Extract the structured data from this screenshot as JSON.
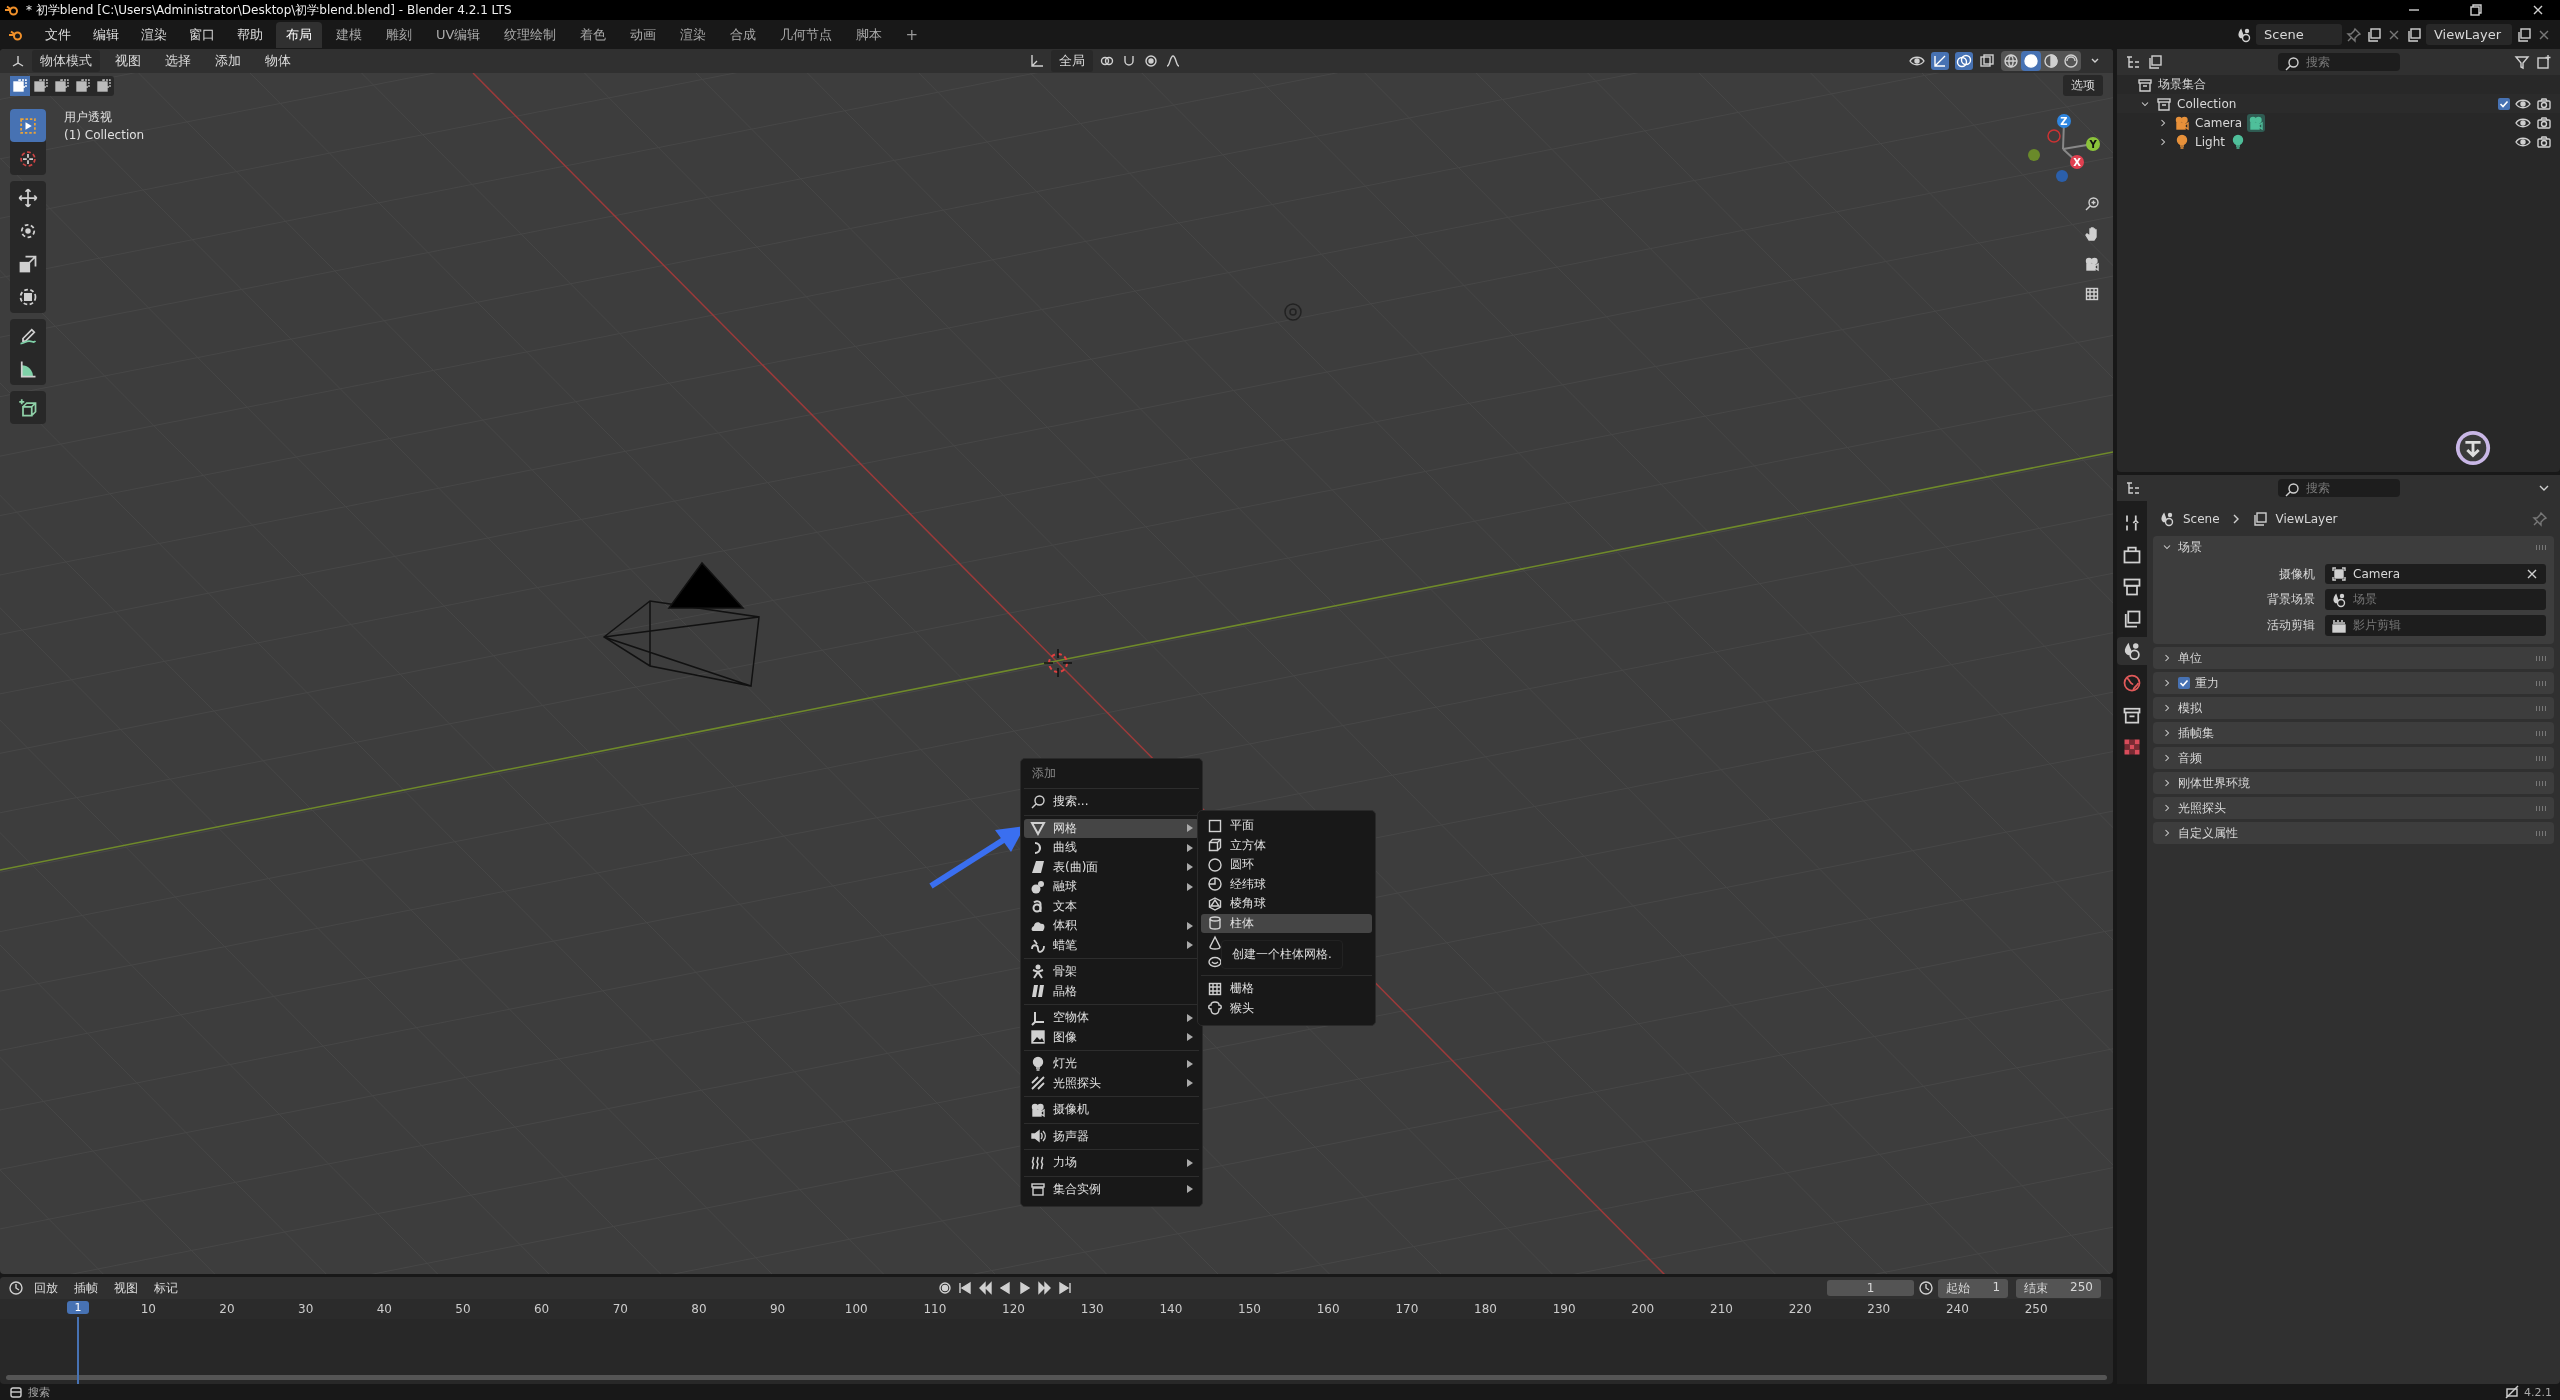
{
  "title_bar": {
    "title": "* 初学blend [C:\\Users\\Administrator\\Desktop\\初学blend.blend] - Blender 4.2.1 LTS"
  },
  "menu_bar": [
    "文件",
    "编辑",
    "渲染",
    "窗口",
    "帮助"
  ],
  "workspaces": [
    {
      "label": "布局",
      "selected": true
    },
    {
      "label": "建模",
      "selected": false
    },
    {
      "label": "雕刻",
      "selected": false
    },
    {
      "label": "UV编辑",
      "selected": false
    },
    {
      "label": "纹理绘制",
      "selected": false
    },
    {
      "label": "着色",
      "selected": false
    },
    {
      "label": "动画",
      "selected": false
    },
    {
      "label": "渲染",
      "selected": false
    },
    {
      "label": "合成",
      "selected": false
    },
    {
      "label": "几何节点",
      "selected": false
    },
    {
      "label": "脚本",
      "selected": false
    }
  ],
  "add_workspace": "+",
  "scene": "Scene",
  "view_layer": "ViewLayer",
  "viewport": {
    "mode": "物体模式",
    "menus": [
      "视图",
      "选择",
      "添加",
      "物体"
    ],
    "orientation": "全局",
    "options": "选项",
    "select_modes": [
      {
        "selected": true
      },
      {
        "selected": false
      },
      {
        "selected": false
      },
      {
        "selected": false
      },
      {
        "selected": false
      }
    ],
    "shading": [
      {
        "kind": "wireframe",
        "selected": false
      },
      {
        "kind": "solid",
        "selected": true
      },
      {
        "kind": "material",
        "selected": false
      },
      {
        "kind": "rendered",
        "selected": false
      }
    ],
    "overlay_text": [
      "用户透视",
      "(1) Collection"
    ],
    "tools": [
      [
        {
          "kind": "sel",
          "selected": true
        },
        {
          "kind": "cursor3d",
          "selected": false
        }
      ],
      [
        {
          "kind": "move",
          "selected": false
        },
        {
          "kind": "rotate",
          "selected": false
        },
        {
          "kind": "scale",
          "selected": false
        },
        {
          "kind": "transform",
          "selected": false
        }
      ],
      [
        {
          "kind": "annotate",
          "selected": false
        },
        {
          "kind": "measure",
          "selected": false
        }
      ],
      [
        {
          "kind": "addcube",
          "selected": false
        }
      ]
    ],
    "gizmo": {
      "x": "X",
      "y": "Y",
      "z": "Z"
    }
  },
  "add_menu": {
    "title": "添加",
    "groups": [
      [
        {
          "label": "搜索...",
          "kind": "search",
          "has_submenu": false,
          "selected": false
        }
      ],
      [
        {
          "label": "网格",
          "kind": "mesh",
          "has_submenu": true,
          "selected": true
        },
        {
          "label": "曲线",
          "kind": "curve",
          "has_submenu": true,
          "selected": false
        },
        {
          "label": "表(曲)面",
          "kind": "surface",
          "has_submenu": true,
          "selected": false
        },
        {
          "label": "融球",
          "kind": "metaball",
          "has_submenu": true,
          "selected": false
        },
        {
          "label": "文本",
          "kind": "text",
          "has_submenu": false,
          "selected": false
        },
        {
          "label": "体积",
          "kind": "volume",
          "has_submenu": true,
          "selected": false
        },
        {
          "label": "蜡笔",
          "kind": "gpencil",
          "has_submenu": true,
          "selected": false
        }
      ],
      [
        {
          "label": "骨架",
          "kind": "armature",
          "has_submenu": false,
          "selected": false
        },
        {
          "label": "晶格",
          "kind": "lattice",
          "has_submenu": false,
          "selected": false
        }
      ],
      [
        {
          "label": "空物体",
          "kind": "empty",
          "has_submenu": true,
          "selected": false
        },
        {
          "label": "图像",
          "kind": "image",
          "has_submenu": true,
          "selected": false
        }
      ],
      [
        {
          "label": "灯光",
          "kind": "light",
          "has_submenu": true,
          "selected": false
        },
        {
          "label": "光照探头",
          "kind": "lightprobe",
          "has_submenu": true,
          "selected": false
        }
      ],
      [
        {
          "label": "摄像机",
          "kind": "camera",
          "has_submenu": false,
          "selected": false
        }
      ],
      [
        {
          "label": "扬声器",
          "kind": "speaker",
          "has_submenu": false,
          "selected": false
        }
      ],
      [
        {
          "label": "力场",
          "kind": "force",
          "has_submenu": true,
          "selected": false
        }
      ],
      [
        {
          "label": "集合实例",
          "kind": "instance",
          "has_submenu": true,
          "selected": false
        }
      ]
    ]
  },
  "mesh_submenu": {
    "groups": [
      [
        {
          "label": "平面",
          "kind": "plane",
          "selected": false
        },
        {
          "label": "立方体",
          "kind": "cube",
          "selected": false
        },
        {
          "label": "圆环",
          "kind": "circle",
          "selected": false
        },
        {
          "label": "经纬球",
          "kind": "uvsphere",
          "selected": false
        },
        {
          "label": "棱角球",
          "kind": "icosphere",
          "selected": false
        },
        {
          "label": "柱体",
          "kind": "cylinder",
          "selected": true
        },
        {
          "kind": "cone",
          "selected": false
        },
        {
          "kind": "torus",
          "selected": false
        }
      ],
      [
        {
          "label": "栅格",
          "kind": "grid",
          "selected": false
        },
        {
          "label": "猴头",
          "kind": "monkey",
          "selected": false
        }
      ]
    ],
    "tooltip": "创建一个柱体网格."
  },
  "outliner": {
    "search_placeholder": "搜索",
    "root": "场景集合",
    "tree": [
      {
        "label": "Collection",
        "kind": "collection",
        "expanded": true,
        "checked": true,
        "children": [
          {
            "label": "Camera",
            "kind": "camera",
            "expanded": false
          },
          {
            "label": "Light",
            "kind": "light",
            "expanded": false
          }
        ]
      }
    ]
  },
  "properties": {
    "search_placeholder": "搜索",
    "tabs": [
      {
        "kind": "wrench",
        "selected": false
      },
      {
        "kind": "render",
        "selected": false
      },
      {
        "kind": "output",
        "selected": false
      },
      {
        "kind": "viewlayer",
        "selected": false
      },
      {
        "kind": "scene",
        "selected": true
      },
      {
        "kind": "world",
        "selected": false
      },
      {
        "kind": "collection",
        "selected": false
      },
      {
        "kind": "texture",
        "selected": false
      }
    ],
    "breadcrumb": [
      "Scene",
      "ViewLayer"
    ],
    "panels": [
      {
        "label": "场景",
        "expanded": true,
        "fields": [
          {
            "label": "摄像机",
            "value": "Camera",
            "kind": "camsel"
          },
          {
            "label": "背景场景",
            "placeholder": "场景",
            "kind": "scene"
          },
          {
            "label": "活动剪辑",
            "placeholder": "影片剪辑",
            "kind": "clip"
          }
        ]
      },
      {
        "label": "单位",
        "expanded": false
      },
      {
        "label": "重力",
        "expanded": false,
        "checked": true
      },
      {
        "label": "模拟",
        "expanded": false
      },
      {
        "label": "插帧集",
        "expanded": false
      },
      {
        "label": "音频",
        "expanded": false
      },
      {
        "label": "刚体世界环境",
        "expanded": false
      },
      {
        "label": "光照探头",
        "expanded": false
      },
      {
        "label": "自定义属性",
        "expanded": false
      }
    ]
  },
  "timeline": {
    "menus": [
      "回放",
      "插帧",
      "视图",
      "标记"
    ],
    "current_frame": "1",
    "start_label": "起始",
    "start": "1",
    "end_label": "结束",
    "end": "250",
    "playhead": "1",
    "ruler": [
      "10",
      "20",
      "30",
      "40",
      "50",
      "60",
      "70",
      "80",
      "90",
      "100",
      "110",
      "120",
      "130",
      "140",
      "150",
      "160",
      "170",
      "180",
      "190",
      "200",
      "210",
      "220",
      "230",
      "240",
      "250"
    ]
  },
  "status_bar": {
    "left": "搜索",
    "version": "4.2.1"
  }
}
